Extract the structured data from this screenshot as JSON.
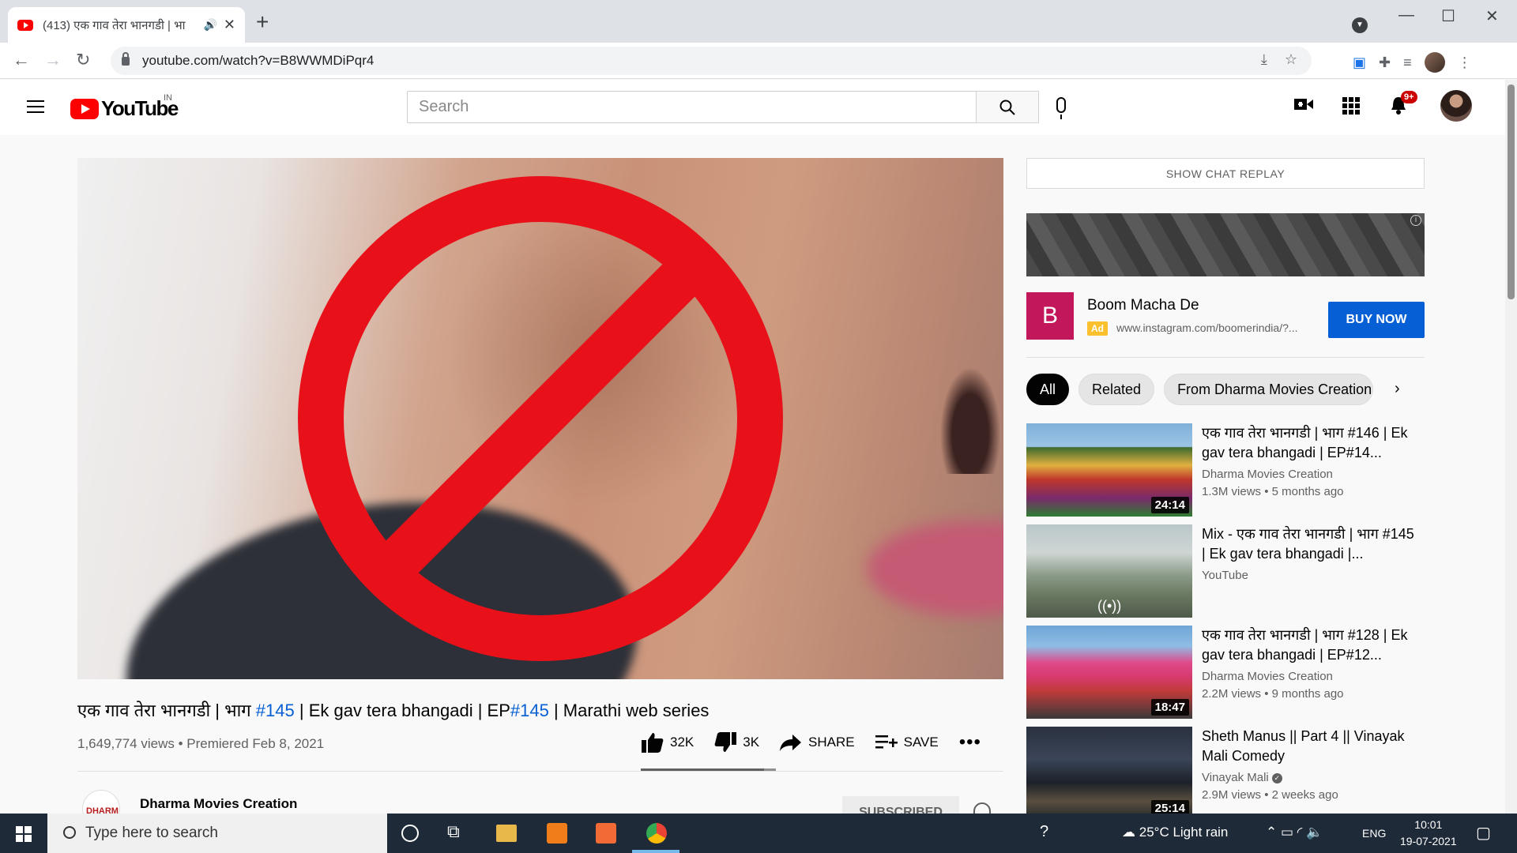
{
  "browser": {
    "tab_title": "(413) एक गाव तेरा भानगडी | भा",
    "url": "youtube.com/watch?v=B8WWMDiPqr4"
  },
  "header": {
    "logo_text": "YouTube",
    "country": "IN",
    "search_placeholder": "Search",
    "notif_badge": "9+"
  },
  "video": {
    "title_part1": "एक गाव तेरा भानगडी | भाग ",
    "hashtag1": "#145",
    "title_part2": " | Ek gav tera bhangadi | EP",
    "hashtag2": "#145",
    "title_part3": " | Marathi web series",
    "meta": "1,649,774 views • Premiered Feb 8, 2021",
    "likes": "32K",
    "dislikes": "3K",
    "share_label": "SHARE",
    "save_label": "SAVE",
    "like_ratio": 0.91,
    "channel": "Dharma Movies Creation",
    "channel_avatar_text": "DHARMA",
    "subscribe_label": "SUBSCRIBED"
  },
  "sidebar": {
    "chat_replay": "SHOW CHAT REPLAY",
    "ad": {
      "logo_letter": "B",
      "title": "Boom Macha De",
      "tag": "Ad",
      "url": "www.instagram.com/boomerindia/?...",
      "cta": "BUY NOW"
    },
    "chips": [
      "All",
      "Related",
      "From Dharma Movies Creation"
    ],
    "recommendations": [
      {
        "title": "एक गाव तेरा भानगडी | भाग #146 | Ek gav tera bhangadi | EP#14...",
        "channel": "Dharma Movies Creation",
        "views": "1.3M views • 5 months ago",
        "duration": "24:14",
        "verified": false
      },
      {
        "title": "Mix - एक गाव तेरा भानगडी | भाग #145 | Ek gav tera bhangadi |...",
        "channel": "YouTube",
        "views": "",
        "duration": "((•))",
        "verified": false
      },
      {
        "title": "एक गाव तेरा भानगडी | भाग #128 | Ek gav tera bhangadi | EP#12...",
        "channel": "Dharma Movies Creation",
        "views": "2.2M views • 9 months ago",
        "duration": "18:47",
        "verified": false
      },
      {
        "title": "Sheth Manus || Part 4 || Vinayak Mali Comedy",
        "channel": "Vinayak Mali",
        "views": "2.9M views • 2 weeks ago",
        "duration": "25:14",
        "verified": true
      }
    ]
  },
  "taskbar": {
    "search_placeholder": "Type here to search",
    "weather": "25°C  Light rain",
    "lang": "ENG",
    "time": "10:01",
    "date": "19-07-2021"
  }
}
